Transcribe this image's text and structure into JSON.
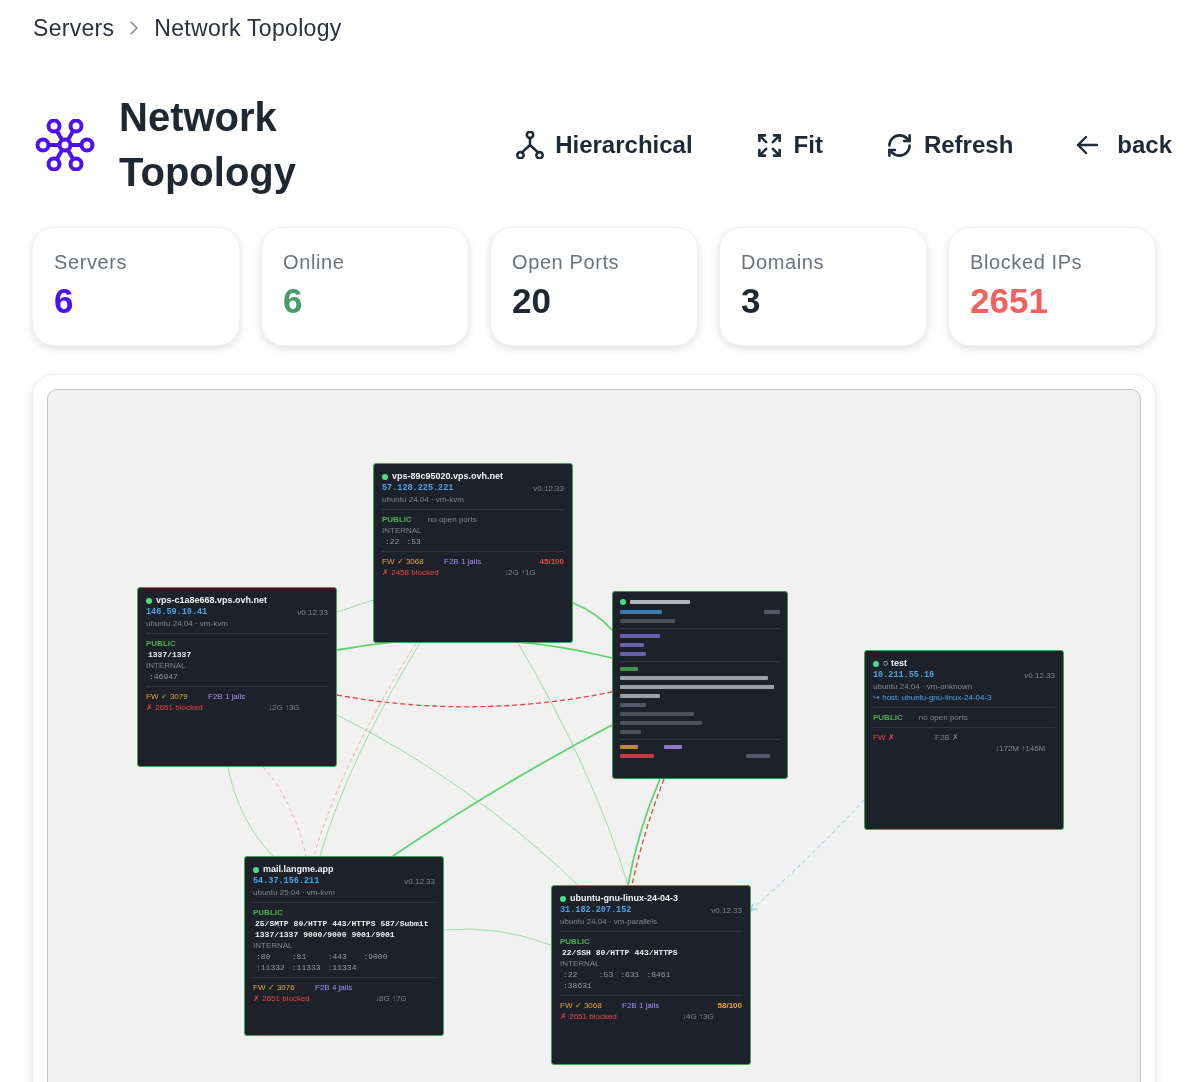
{
  "breadcrumb": [
    {
      "label": "Servers"
    },
    {
      "label": "Network Topology"
    }
  ],
  "title": "Network Topology",
  "toolbar": [
    {
      "kind": "layout",
      "label": "Hierarchical"
    },
    {
      "kind": "fit",
      "label": "Fit"
    },
    {
      "kind": "refresh",
      "label": "Refresh"
    },
    {
      "kind": "back",
      "label": "back"
    }
  ],
  "stats": [
    {
      "label": "Servers",
      "value": "6",
      "color": "#4d0ff3"
    },
    {
      "label": "Online",
      "value": "6",
      "color": "#4a9a6c"
    },
    {
      "label": "Open Ports",
      "value": "20",
      "color": "#1f2733"
    },
    {
      "label": "Domains",
      "value": "3",
      "color": "#1f2733"
    },
    {
      "label": "Blocked IPs",
      "value": "2651",
      "color": "#f2625c"
    }
  ],
  "nodes": [
    {
      "kind": "server",
      "online": true,
      "name": "vps-89c95020.vps.ovh.net",
      "ip": "57.128.225.221",
      "version": "v0.12.33",
      "os": "ubuntu 24.04 · vm-kvm",
      "public": {
        "label": "PUBLIC",
        "note": "no open ports"
      },
      "internal": {
        "label": "INTERNAL",
        "ports": [
          ":22",
          ":53"
        ]
      },
      "firewall": {
        "text": "FW ✓ 3068",
        "ok": true
      },
      "fail2ban": {
        "text": "F2B 1 jails",
        "active": true
      },
      "score": {
        "text": "45/100",
        "critical": true
      },
      "blocked": "✗ 2458 blocked",
      "traffic": "↓2G ↑1G"
    },
    {
      "kind": "server",
      "online": true,
      "name": "vps-c1a8e668.vps.ovh.net",
      "ip": "146.59.10.41",
      "version": "v0.12.33",
      "os": "ubuntu 24.04 · vm-kvm",
      "public": {
        "label": "PUBLIC",
        "ports": [
          "1337/1337"
        ]
      },
      "internal": {
        "label": "INTERNAL",
        "ports": [
          ":46947"
        ]
      },
      "firewall": {
        "text": "FW ✓ 3079",
        "ok": true
      },
      "fail2ban": {
        "text": "F2B 1 jails",
        "active": true
      },
      "blocked": "✗ 2651 blocked",
      "traffic": "↓2G ↑3G"
    },
    {
      "kind": "redacted",
      "online": true
    },
    {
      "kind": "server",
      "online": true,
      "name": "○ test",
      "ip": "10.211.55.16",
      "version": "v0.12.33",
      "os": "ubuntu 24.04 · vm-unknown",
      "host": "↪ host: ubuntu-gnu-linux-24-04-3",
      "public": {
        "label": "PUBLIC",
        "note": "no open ports"
      },
      "firewall": {
        "text": "FW ✗",
        "ok": false
      },
      "fail2ban": {
        "text": "F2B ✗",
        "active": false
      },
      "traffic": "↓172M ↑146M"
    },
    {
      "kind": "server",
      "online": true,
      "name": "mail.langme.app",
      "ip": "54.37.156.211",
      "version": "v0.12.33",
      "os": "ubuntu 25.04 · vm-kvm",
      "public": {
        "label": "PUBLIC",
        "ports": [
          "25/SMTP",
          "80/HTTP",
          "443/HTTPS",
          "587/Submit",
          "1337/1337",
          "9000/9000",
          "9001/9001"
        ]
      },
      "internal": {
        "label": "INTERNAL",
        "ports": [
          ":80",
          ":81",
          ":443",
          ":9000",
          ":11332",
          ":11333",
          ":11334"
        ]
      },
      "firewall": {
        "text": "FW ✓ 3076",
        "ok": true
      },
      "fail2ban": {
        "text": "F2B 4 jails",
        "active": true
      },
      "blocked": "✗ 2651 blocked",
      "traffic": "↓8G ↑7G"
    },
    {
      "kind": "server",
      "online": true,
      "name": "ubuntu-gnu-linux-24-04-3",
      "ip": "31.182.207.152",
      "version": "v0.12.33",
      "os": "ubuntu 24.04 · vm-parallels",
      "public": {
        "label": "PUBLIC",
        "ports": [
          "22/SSH",
          "80/HTTP",
          "443/HTTPS"
        ]
      },
      "internal": {
        "label": "INTERNAL",
        "ports": [
          ":22",
          ":53",
          ":631",
          ":8461",
          ":38631"
        ]
      },
      "firewall": {
        "text": "FW ✓ 3068",
        "ok": true
      },
      "fail2ban": {
        "text": "F2B 1 jails",
        "active": true
      },
      "score": {
        "text": "58/100",
        "critical": false
      },
      "blocked": "✗ 2651 blocked",
      "traffic": "↓4G ↑3G"
    }
  ],
  "edges": [
    {
      "kind": "heavy"
    },
    {
      "kind": "heavy"
    },
    {
      "kind": "dashed"
    },
    {
      "kind": "light"
    },
    {
      "kind": "light"
    },
    {
      "kind": "light"
    },
    {
      "kind": "faint"
    },
    {
      "kind": "light"
    },
    {
      "kind": "faint"
    },
    {
      "kind": "light"
    },
    {
      "kind": "heavy"
    },
    {
      "kind": "heavy"
    },
    {
      "kind": "dashed"
    },
    {
      "kind": "light"
    },
    {
      "kind": "host"
    }
  ]
}
